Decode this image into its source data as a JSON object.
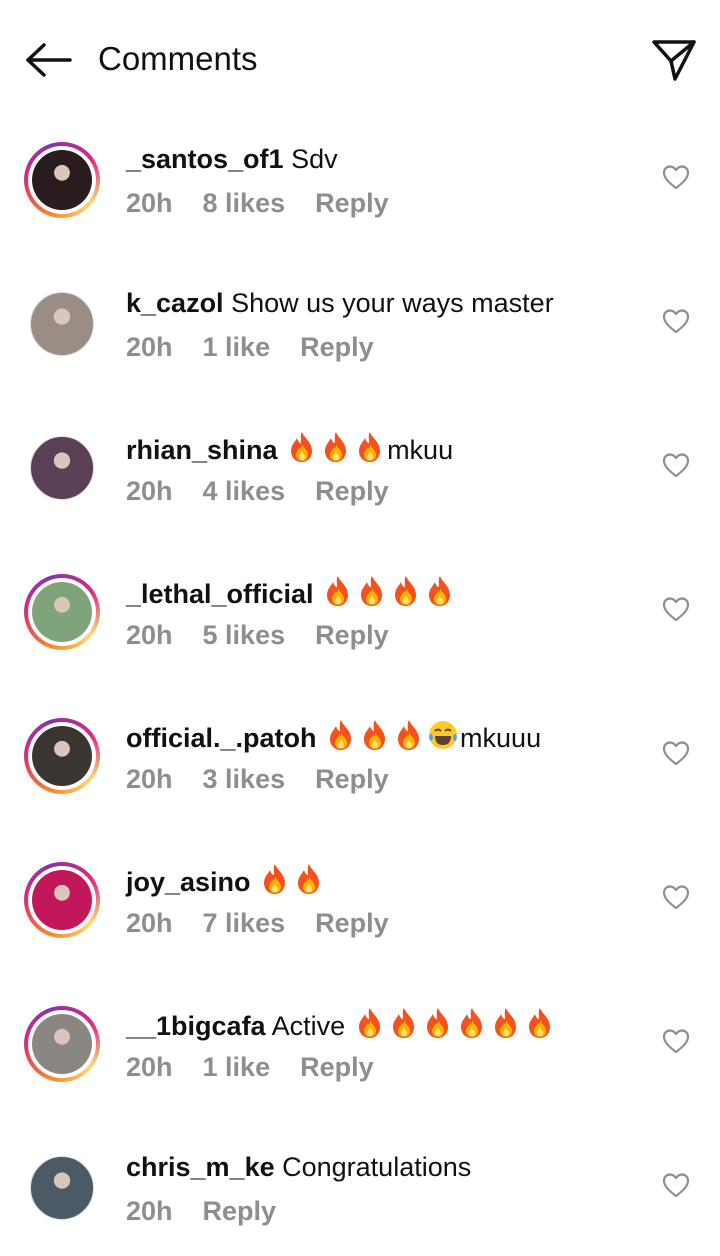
{
  "header": {
    "title": "Comments",
    "back_icon": "arrow-left-icon",
    "share_icon": "send-paper-plane-icon"
  },
  "colors": {
    "meta_text": "#8e8e8e",
    "story_ring": [
      "#f58529",
      "#dd2a7b",
      "#8134af",
      "#feda77"
    ]
  },
  "comments": [
    {
      "username": "_santos_of1",
      "text": "Sdv",
      "time": "20h",
      "likes": "8 likes",
      "reply": "Reply",
      "story_ring": true,
      "avatar_color": "#2a1b1e"
    },
    {
      "username": "k_cazol",
      "text": "Show us your ways master",
      "time": "20h",
      "likes": "1 like",
      "reply": "Reply",
      "story_ring": false,
      "avatar_color": "#9a8d85"
    },
    {
      "username": "rhian_shina",
      "text": "🔥🔥🔥mkuu",
      "time": "20h",
      "likes": "4 likes",
      "reply": "Reply",
      "story_ring": false,
      "avatar_color": "#5b3f55"
    },
    {
      "username": "_lethal_official",
      "text": "🔥🔥🔥🔥",
      "time": "20h",
      "likes": "5 likes",
      "reply": "Reply",
      "story_ring": true,
      "avatar_color": "#7fa37a"
    },
    {
      "username": "official._.patoh",
      "text": "🔥🔥🔥😂mkuuu",
      "time": "20h",
      "likes": "3 likes",
      "reply": "Reply",
      "story_ring": true,
      "avatar_color": "#3b3531"
    },
    {
      "username": "joy_asino",
      "text": "🔥🔥",
      "time": "20h",
      "likes": "7 likes",
      "reply": "Reply",
      "story_ring": true,
      "avatar_color": "#c2185b"
    },
    {
      "username": "__1bigcafa",
      "text": "Active 🔥🔥🔥🔥🔥🔥",
      "time": "20h",
      "likes": "1 like",
      "reply": "Reply",
      "story_ring": true,
      "avatar_color": "#8a8682"
    },
    {
      "username": "chris_m_ke",
      "text": "Congratulations",
      "time": "20h",
      "likes": "",
      "reply": "Reply",
      "story_ring": false,
      "avatar_color": "#4c5a66"
    }
  ]
}
